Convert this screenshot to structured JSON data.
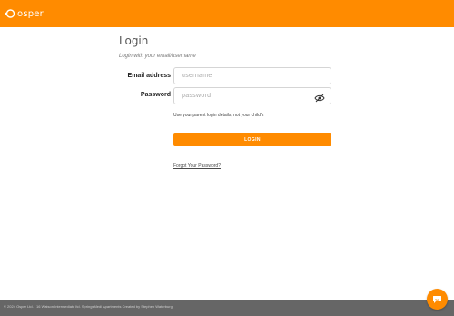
{
  "brand": {
    "name": "osper",
    "accent": "#ff8b00"
  },
  "login": {
    "title": "Login",
    "subtitle": "Login with your email/username",
    "email_label": "Email address",
    "email_placeholder": "username",
    "password_label": "Password",
    "password_placeholder": "password",
    "hint": "Use your parent login details, not your child's",
    "submit_label": "LOGIN",
    "forgot_link": "Forgot Your Password?"
  },
  "icons": {
    "logo": "osper-logo-icon",
    "password_toggle": "eye-off-icon",
    "chat": "chat-icon"
  },
  "footer": {
    "text": "© 2024 Osper Ltd. | 16 Watson Intermediate ltd. SpringsMedi Apartments Created by Stephen Waterburg"
  }
}
